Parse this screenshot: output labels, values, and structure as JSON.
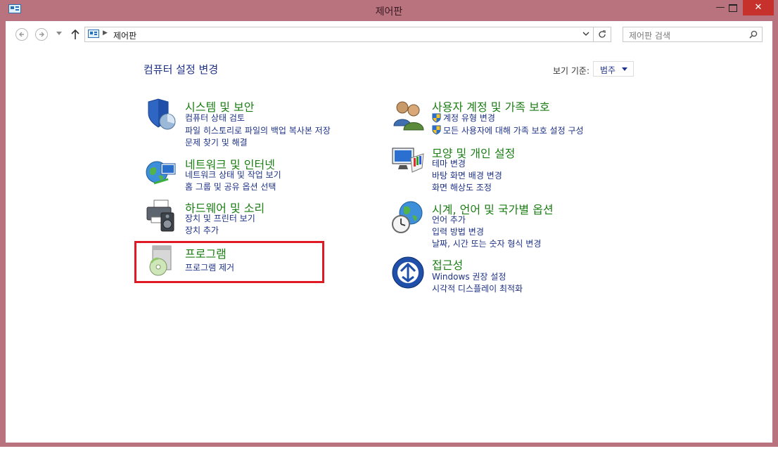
{
  "window": {
    "title": "제어판",
    "close_label": "✕",
    "minimize_label": "—"
  },
  "address_bar": {
    "path": "제어판"
  },
  "search": {
    "placeholder": "제어판 검색"
  },
  "heading": "컴퓨터 설정 변경",
  "view_by": {
    "label": "보기 기준:",
    "value": "범주"
  },
  "categories_left": [
    {
      "title": "시스템 및 보안",
      "links": [
        "컴퓨터 상태 검토",
        "파일 히스토리로 파일의 백업 복사본 저장",
        "문제 찾기 및 해결"
      ],
      "icon": "shield-icon"
    },
    {
      "title": "네트워크 및 인터넷",
      "links": [
        "네트워크 상태 및 작업 보기",
        "홈 그룹 및 공유 옵션 선택"
      ],
      "icon": "network-globe-icon"
    },
    {
      "title": "하드웨어 및 소리",
      "links": [
        "장치 및 프린터 보기",
        "장치 추가"
      ],
      "icon": "printer-speaker-icon"
    },
    {
      "title": "프로그램",
      "links": [
        "프로그램 제거"
      ],
      "icon": "program-disc-icon"
    }
  ],
  "categories_right": [
    {
      "title": "사용자 계정 및 가족 보호",
      "links": [
        "계정 유형 변경",
        "모든 사용자에 대해 가족 보호 설정 구성"
      ],
      "icon": "users-icon"
    },
    {
      "title": "모양 및 개인 설정",
      "links": [
        "테마 변경",
        "바탕 화면 배경 변경",
        "화면 해상도 조정"
      ],
      "icon": "monitor-palette-icon"
    },
    {
      "title": "시계, 언어 및 국가별 옵션",
      "links": [
        "언어 추가",
        "입력 방법 변경",
        "날짜, 시간 또는 숫자 형식 변경"
      ],
      "icon": "clock-globe-icon"
    },
    {
      "title": "접근성",
      "links": [
        "Windows 권장 설정",
        "시각적 디스플레이 최적화"
      ],
      "icon": "accessibility-icon"
    }
  ],
  "colors": {
    "frame": "#b8737f",
    "title_green": "#1b7e14",
    "link_blue": "#1e3287",
    "highlight": "#e01a24",
    "close_red": "#c7312b"
  }
}
